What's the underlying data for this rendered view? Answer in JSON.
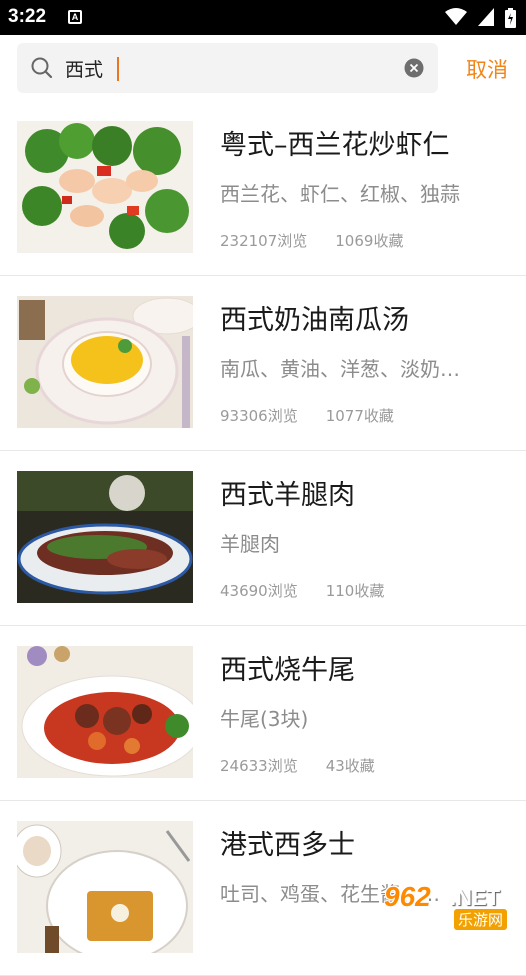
{
  "status_bar": {
    "time": "3:22",
    "notification_icon": "A"
  },
  "search": {
    "query": "西式",
    "cancel_label": "取消"
  },
  "results": [
    {
      "title": "粤式–西兰花炒虾仁",
      "ingredients": "西兰花、虾仁、红椒、独蒜",
      "views": "232107浏览",
      "favorites": "1069收藏"
    },
    {
      "title": "西式奶油南瓜汤",
      "ingredients": "南瓜、黄油、洋葱、淡奶…",
      "views": "93306浏览",
      "favorites": "1077收藏"
    },
    {
      "title": "西式羊腿肉",
      "ingredients": "羊腿肉",
      "views": "43690浏览",
      "favorites": "110收藏"
    },
    {
      "title": "西式烧牛尾",
      "ingredients": "牛尾(3块)",
      "views": "24633浏览",
      "favorites": "43收藏"
    },
    {
      "title": "港式西多士",
      "ingredients": "吐司、鸡蛋、花生酱、…",
      "views": "",
      "favorites": ""
    }
  ],
  "watermark": {
    "brand": "962",
    "suffix": ".NET",
    "site": "乐游网"
  },
  "colors": {
    "accent": "#f08519",
    "status_bar": "#000000"
  }
}
